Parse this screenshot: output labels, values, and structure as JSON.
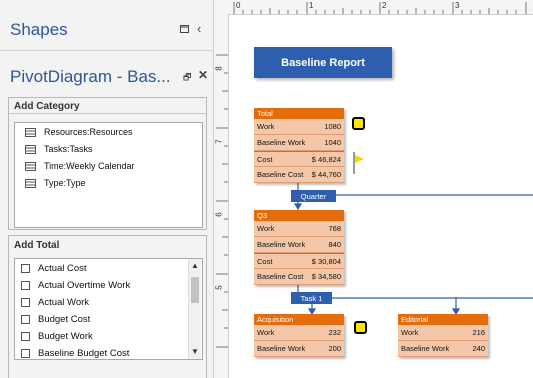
{
  "shapes_panel": {
    "title": "Shapes"
  },
  "pivot_panel": {
    "title": "PivotDiagram - Bas...",
    "add_category": {
      "header": "Add Category",
      "items": [
        "Resources:Resources",
        "Tasks:Tasks",
        "Time:Weekly Calendar",
        "Type:Type"
      ]
    },
    "add_total": {
      "header": "Add Total",
      "items": [
        "Actual Cost",
        "Actual Overtime Work",
        "Actual Work",
        "Budget Cost",
        "Budget Work",
        "Baseline Budget Cost"
      ]
    }
  },
  "ruler": {
    "h_labels": [
      "0",
      "1",
      "2",
      "3"
    ],
    "v_labels": [
      "8",
      "7",
      "6",
      "5"
    ]
  },
  "diagram": {
    "title": "Baseline Report",
    "total_node": {
      "header": "Total",
      "rows": [
        {
          "label": "Work",
          "value": "1080"
        },
        {
          "label": "Baseline Work",
          "value": "1040"
        },
        {
          "label": "Cost",
          "value": "$ 46,824"
        },
        {
          "label": "Baseline Cost",
          "value": "$ 44,760"
        }
      ]
    },
    "quarter_tag": "Quarter",
    "q3_node": {
      "header": "Q3",
      "rows": [
        {
          "label": "Work",
          "value": "768"
        },
        {
          "label": "Baseline Work",
          "value": "840"
        },
        {
          "label": "Cost",
          "value": "$ 30,804"
        },
        {
          "label": "Baseline Cost",
          "value": "$ 34,580"
        }
      ]
    },
    "task_tag": "Task 1",
    "acquisition_node": {
      "header": "Acquisition",
      "rows": [
        {
          "label": "Work",
          "value": "232"
        },
        {
          "label": "Baseline Work",
          "value": "200"
        }
      ]
    },
    "editorial_node": {
      "header": "Editorial",
      "rows": [
        {
          "label": "Work",
          "value": "216"
        },
        {
          "label": "Baseline Work",
          "value": "240"
        }
      ]
    }
  }
}
